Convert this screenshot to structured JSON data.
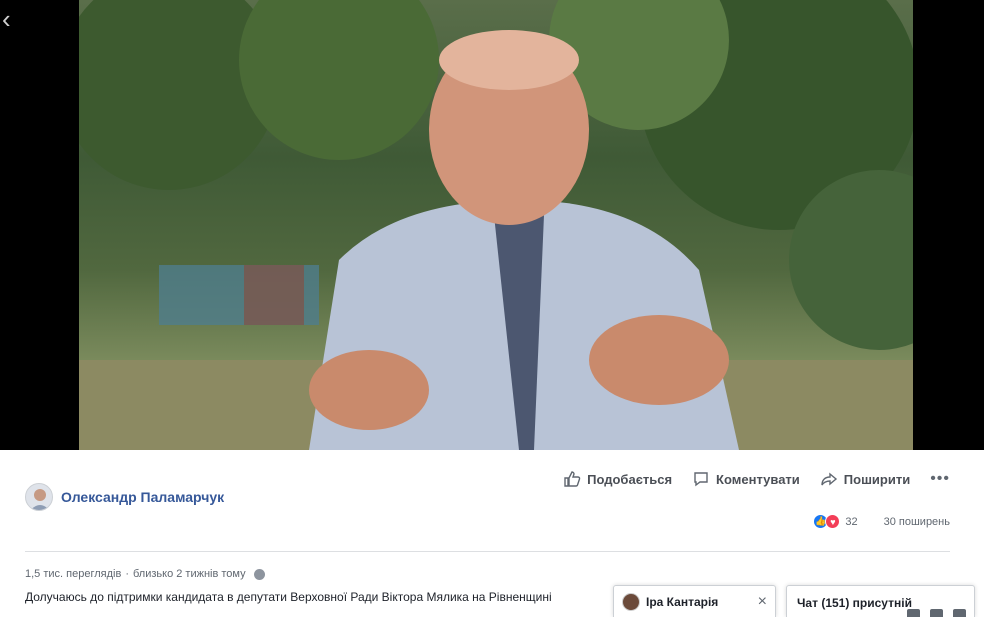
{
  "video": {},
  "author": {
    "name": "Олександр Паламарчук"
  },
  "actions": {
    "like": "Подобається",
    "comment": "Коментувати",
    "share": "Поширити",
    "more": "•••"
  },
  "reactions": {
    "count": "32",
    "shares": "30 поширень"
  },
  "meta": {
    "views": "1,5 тис. переглядів",
    "separator": "·",
    "time": "близько 2 тижнів тому"
  },
  "description": "Долучаюсь до підтримки кандидата в депутати Верховної Ради Віктора Мялика на Рівненщині",
  "chat": {
    "person": "Іра Кантарія",
    "close": "×",
    "bar_title": "Чат (151) присутній"
  }
}
